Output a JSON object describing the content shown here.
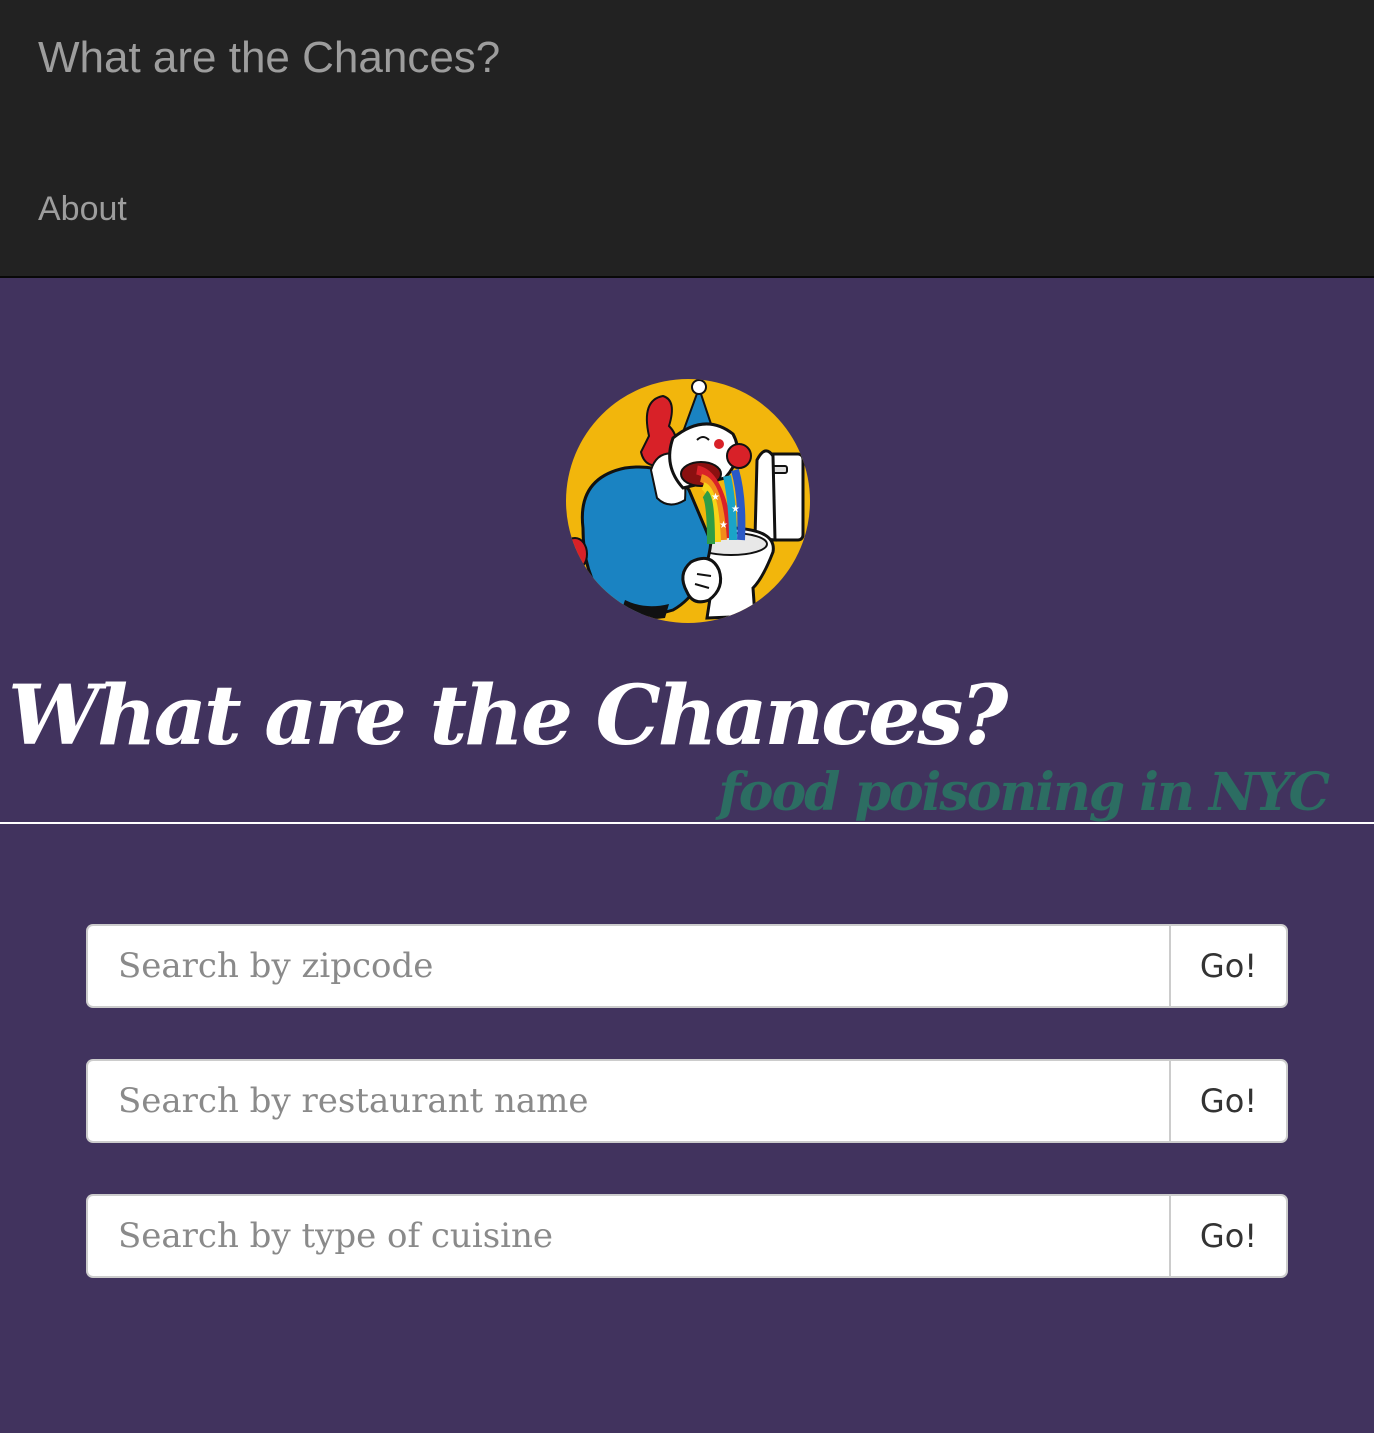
{
  "navbar": {
    "brand": "What are the Chances?",
    "links": [
      {
        "label": "About"
      }
    ]
  },
  "hero": {
    "logo_icon": "clown-vomiting-rainbow-into-toilet-icon",
    "title": "What are the Chances?",
    "subtitle": "food poisoning in NYC"
  },
  "search": {
    "rows": [
      {
        "placeholder": "Search by zipcode",
        "value": "",
        "button_label": "Go!"
      },
      {
        "placeholder": "Search by restaurant name",
        "value": "",
        "button_label": "Go!"
      },
      {
        "placeholder": "Search by type of cuisine",
        "value": "",
        "button_label": "Go!"
      }
    ]
  },
  "colors": {
    "navbar_background": "#222222",
    "navbar_text": "#9d9d9d",
    "page_background": "#41335e",
    "title_text": "#ffffff",
    "subtitle_text": "#2c6d62",
    "logo_circle": "#f2b60c"
  }
}
